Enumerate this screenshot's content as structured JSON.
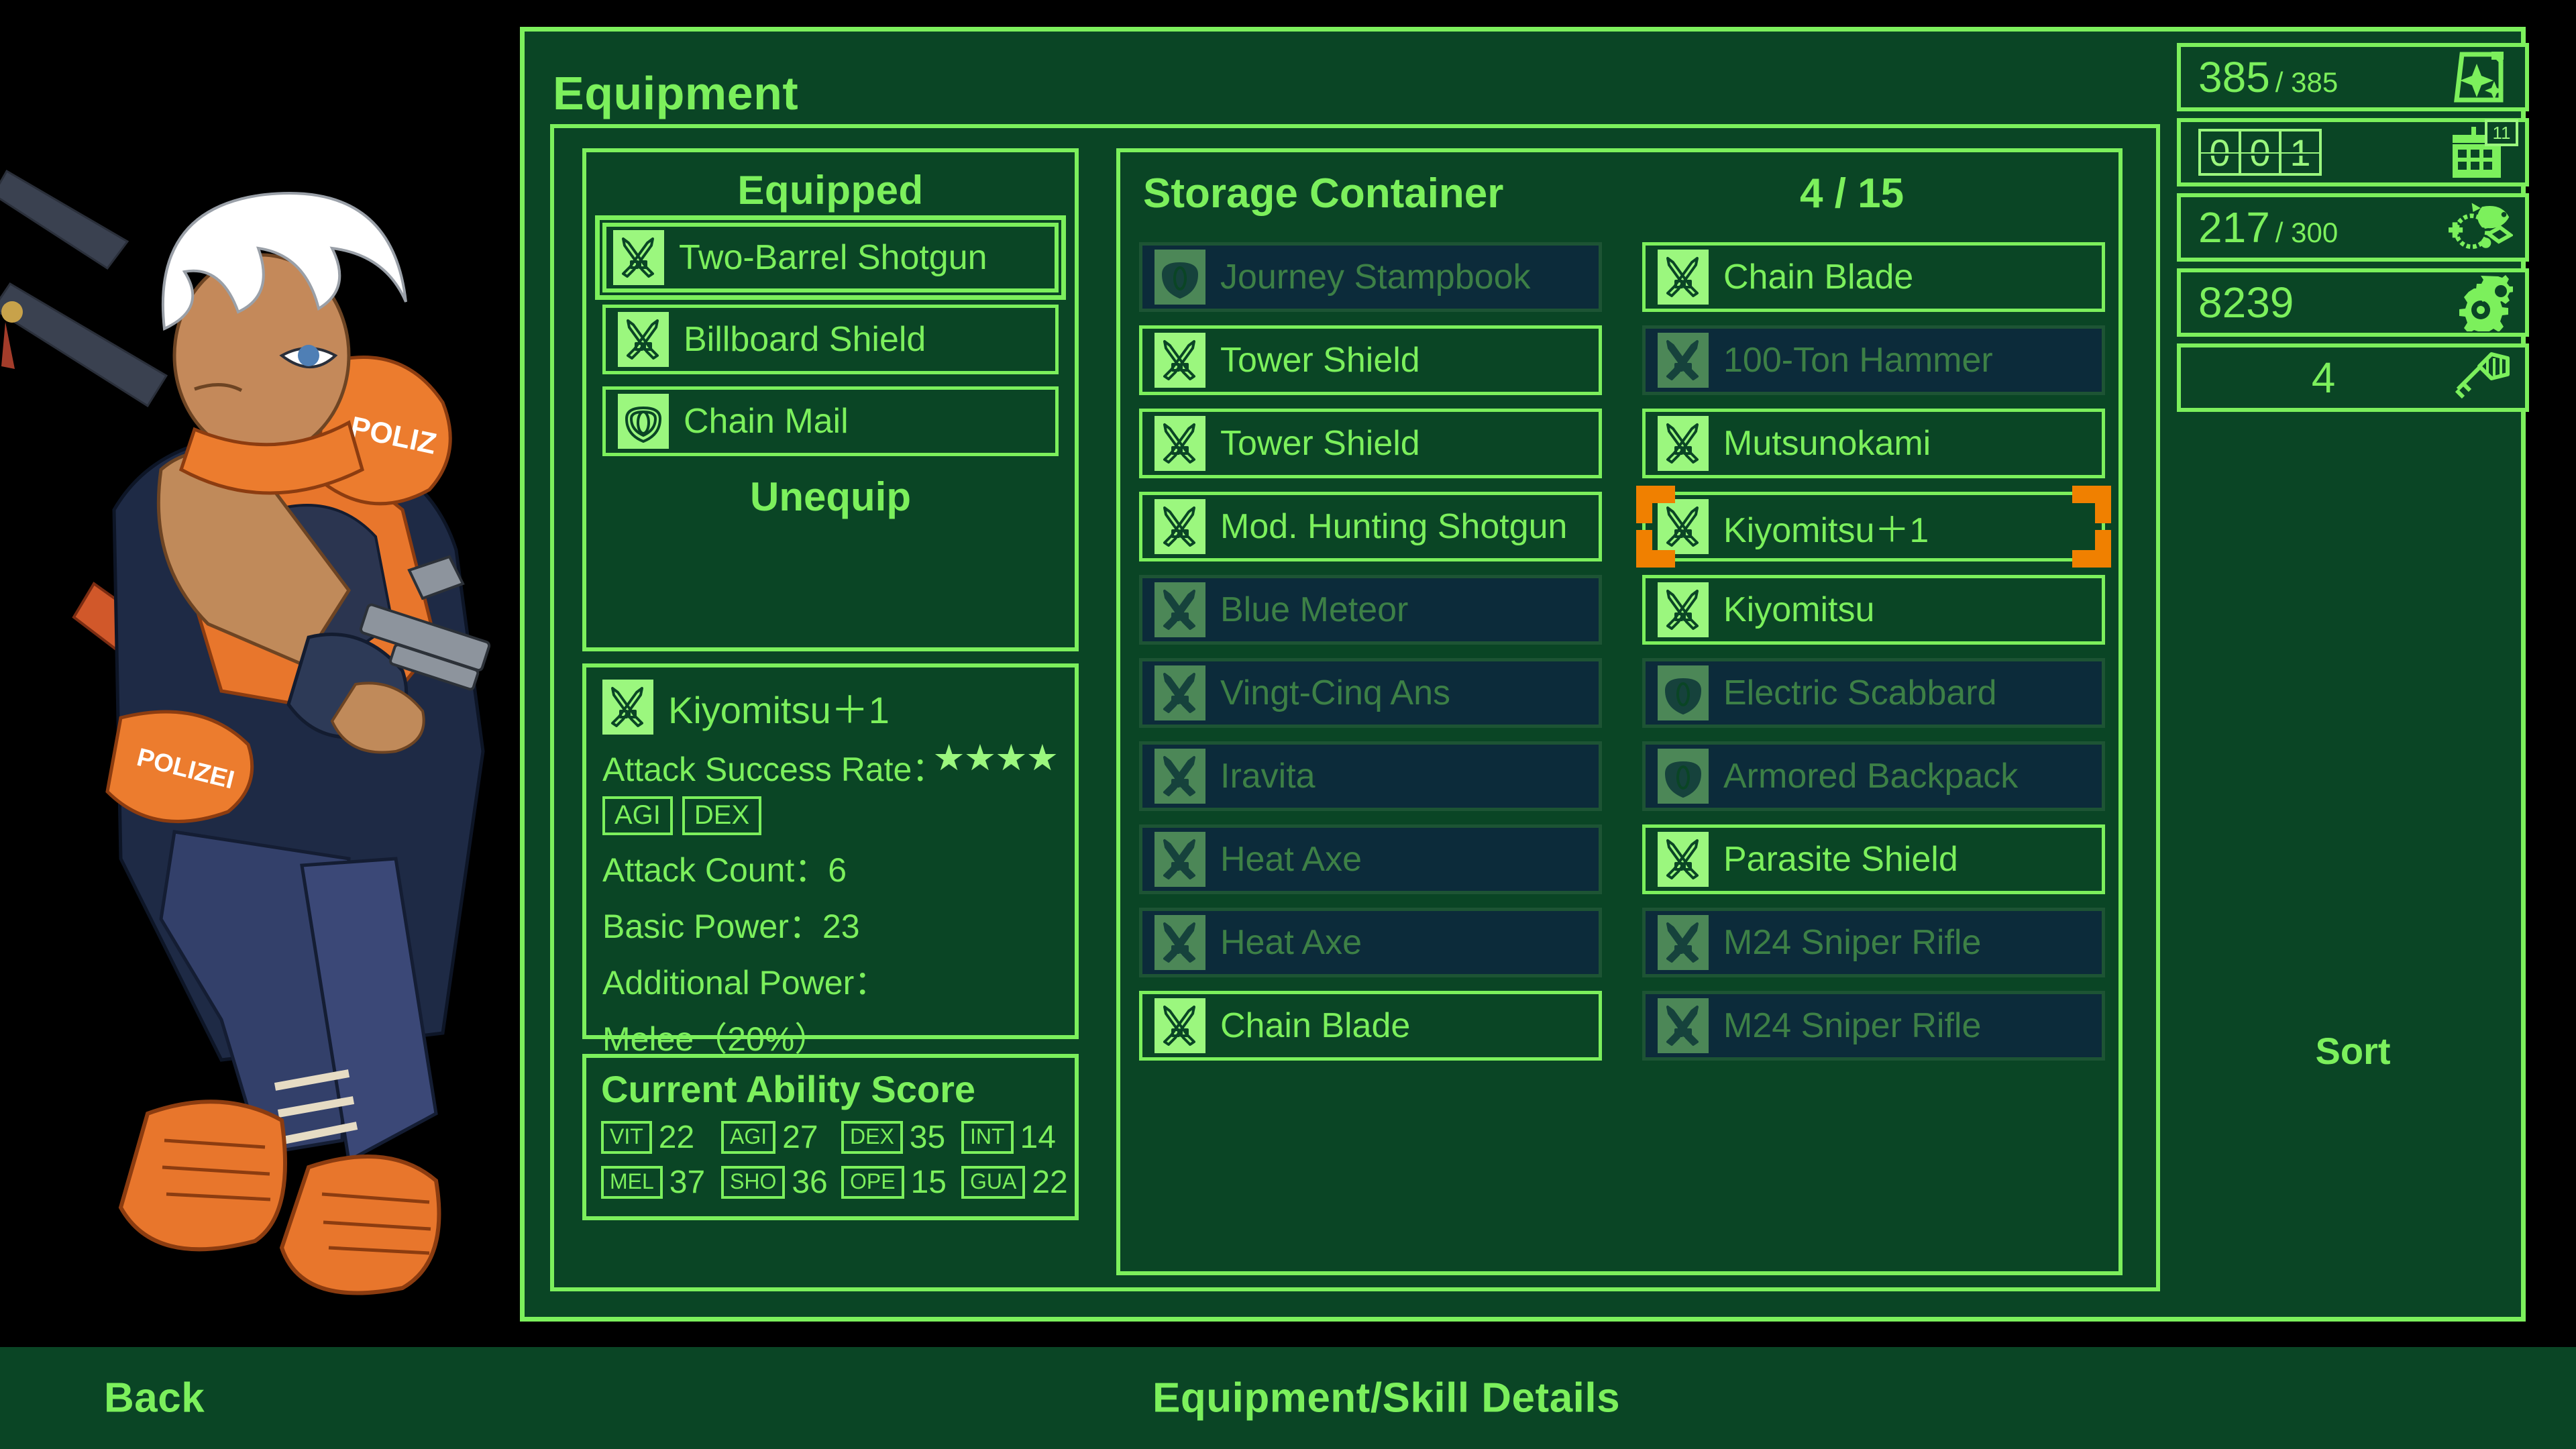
{
  "window": {
    "title": "Equipment"
  },
  "equipped_panel": {
    "heading": "Equipped",
    "unequip_label": "Unequip",
    "items": [
      {
        "label": "Two-Barrel Shotgun",
        "icon": "weapon-icon",
        "state": "selected-equipped"
      },
      {
        "label": "Billboard Shield",
        "icon": "weapon-icon",
        "state": "active"
      },
      {
        "label": "Chain Mail",
        "icon": "armor-icon",
        "state": "active"
      }
    ]
  },
  "detail_panel": {
    "item_name": "Kiyomitsu＋1",
    "icon": "weapon-icon",
    "stars": "★★★★",
    "star_count": 4,
    "attack_success_rate_label": "Attack Success Rate：",
    "attack_success_tags": [
      "AGI",
      "DEX"
    ],
    "attack_count_line": "Attack Count：6",
    "basic_power_line": "Basic Power：23",
    "additional_power_label": "Additional Power：",
    "additional_power_value": "Melee（20%）"
  },
  "ability_panel": {
    "title": "Current Ability Score",
    "row1": [
      {
        "tag": "VIT",
        "value": "22"
      },
      {
        "tag": "AGI",
        "value": "27"
      },
      {
        "tag": "DEX",
        "value": "35"
      },
      {
        "tag": "INT",
        "value": "14"
      }
    ],
    "row2": [
      {
        "tag": "MEL",
        "value": "37"
      },
      {
        "tag": "SHO",
        "value": "36"
      },
      {
        "tag": "OPE",
        "value": "15"
      },
      {
        "tag": "GUA",
        "value": "22"
      }
    ]
  },
  "storage_panel": {
    "title": "Storage Container",
    "count": "4 / 15",
    "items": [
      {
        "label": "Journey Stampbook",
        "icon": "armor-icon",
        "state": "dim"
      },
      {
        "label": "Chain Blade",
        "icon": "weapon-icon",
        "state": "active"
      },
      {
        "label": "Tower Shield",
        "icon": "weapon-icon",
        "state": "active"
      },
      {
        "label": "100-Ton Hammer",
        "icon": "weapon-icon",
        "state": "dim"
      },
      {
        "label": "Tower Shield",
        "icon": "weapon-icon",
        "state": "active"
      },
      {
        "label": "Mutsunokami",
        "icon": "weapon-icon",
        "state": "active"
      },
      {
        "label": "Mod. Hunting Shotgun",
        "icon": "weapon-icon",
        "state": "active"
      },
      {
        "label": "Kiyomitsu＋1",
        "icon": "weapon-icon",
        "state": "selected"
      },
      {
        "label": "Blue Meteor",
        "icon": "weapon-icon",
        "state": "dim"
      },
      {
        "label": "Kiyomitsu",
        "icon": "weapon-icon",
        "state": "active"
      },
      {
        "label": "Vingt-Cinq Ans",
        "icon": "weapon-icon",
        "state": "dim"
      },
      {
        "label": "Electric Scabbard",
        "icon": "armor-icon",
        "state": "dim"
      },
      {
        "label": "Iravita",
        "icon": "weapon-icon",
        "state": "dim"
      },
      {
        "label": "Armored Backpack",
        "icon": "armor-icon",
        "state": "dim"
      },
      {
        "label": "Heat Axe",
        "icon": "weapon-icon",
        "state": "dim"
      },
      {
        "label": "Parasite Shield",
        "icon": "weapon-icon",
        "state": "active"
      },
      {
        "label": "Heat Axe",
        "icon": "weapon-icon",
        "state": "dim"
      },
      {
        "label": "M24 Sniper Rifle",
        "icon": "weapon-icon",
        "state": "dim"
      },
      {
        "label": "Chain Blade",
        "icon": "weapon-icon",
        "state": "active"
      },
      {
        "label": "M24 Sniper Rifle",
        "icon": "weapon-icon",
        "state": "dim"
      }
    ]
  },
  "sidebar": {
    "sort_label": "Sort",
    "resources": [
      {
        "icon": "sparkle-card-icon",
        "value": "385",
        "max": "/ 385"
      },
      {
        "icon": "calendar-icon",
        "value": "001",
        "max": "",
        "badge": "11",
        "type": "counter"
      },
      {
        "icon": "food-icon",
        "value": "217",
        "max": "/ 300"
      },
      {
        "icon": "gears-icon",
        "value": "8239",
        "max": ""
      },
      {
        "icon": "key-icon",
        "value": "4",
        "max": "",
        "align": "center"
      }
    ]
  },
  "bottom_bar": {
    "back_label": "Back",
    "details_label": "Equipment/Skill Details"
  },
  "colors": {
    "panel_bg": "#0a4525",
    "accent_green": "#7cf05c",
    "bright_green": "#9bf77e",
    "dim_bg": "#0c2b3a",
    "dim_text": "#3d8046",
    "selection_orange": "#f08000",
    "screen_bg": "#000000"
  }
}
